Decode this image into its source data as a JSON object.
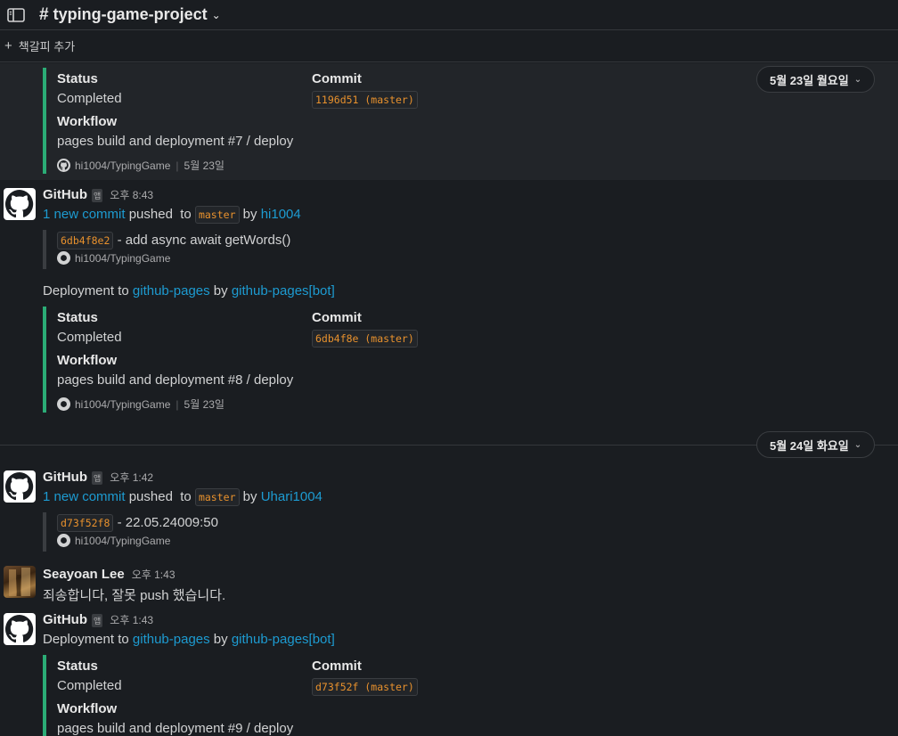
{
  "header": {
    "hash": "#",
    "channel": "typing-game-project",
    "chevron": "⌄"
  },
  "bookmark": {
    "plus": "+",
    "label": "책갈피 추가"
  },
  "dates": [
    {
      "label": "5월 23일 월요일",
      "chevron": "⌄"
    },
    {
      "label": "5월 24일 화요일",
      "chevron": "⌄"
    }
  ],
  "labels": {
    "status": "Status",
    "commit": "Commit",
    "workflow": "Workflow",
    "completed": "Completed"
  },
  "repo": "hi1004/TypingGame",
  "cards": [
    {
      "commit": "1196d51 (master)",
      "workflow": "pages build and deployment #7 / deploy",
      "date": "5월 23일"
    },
    {
      "commit": "6db4f8e (master)",
      "workflow": "pages build and deployment #8 / deploy",
      "date": "5월 23일"
    },
    {
      "commit": "d73f52f (master)",
      "workflow": "pages build and deployment #9 / deploy"
    }
  ],
  "messages": [
    {
      "name": "GitHub",
      "badge": "앱",
      "time": "오후 8:43",
      "push": {
        "count": "1 new commit",
        "pushed": "pushed",
        "to": "to",
        "branch": "master",
        "by": "by",
        "user": "hi1004"
      },
      "commit": {
        "hash": "6db4f8e2",
        "msg": "- add async await getWords()"
      },
      "deploy": {
        "prefix": "Deployment to",
        "target": "github-pages",
        "by": "by",
        "bot": "github-pages[bot]"
      }
    },
    {
      "name": "GitHub",
      "badge": "앱",
      "time": "오후 1:42",
      "push": {
        "count": "1 new commit",
        "pushed": "pushed",
        "to": "to",
        "branch": "master",
        "by": "by",
        "user": "Uhari1004"
      },
      "commit": {
        "hash": "d73f52f8",
        "msg": "- 22.05.24009:50"
      }
    },
    {
      "name": "Seayoan Lee",
      "time": "오후 1:43",
      "text": "죄송합니다, 잘못 push 했습니다."
    },
    {
      "name": "GitHub",
      "badge": "앱",
      "time": "오후 1:43",
      "deploy": {
        "prefix": "Deployment to",
        "target": "github-pages",
        "by": "by",
        "bot": "github-pages[bot]"
      }
    }
  ]
}
